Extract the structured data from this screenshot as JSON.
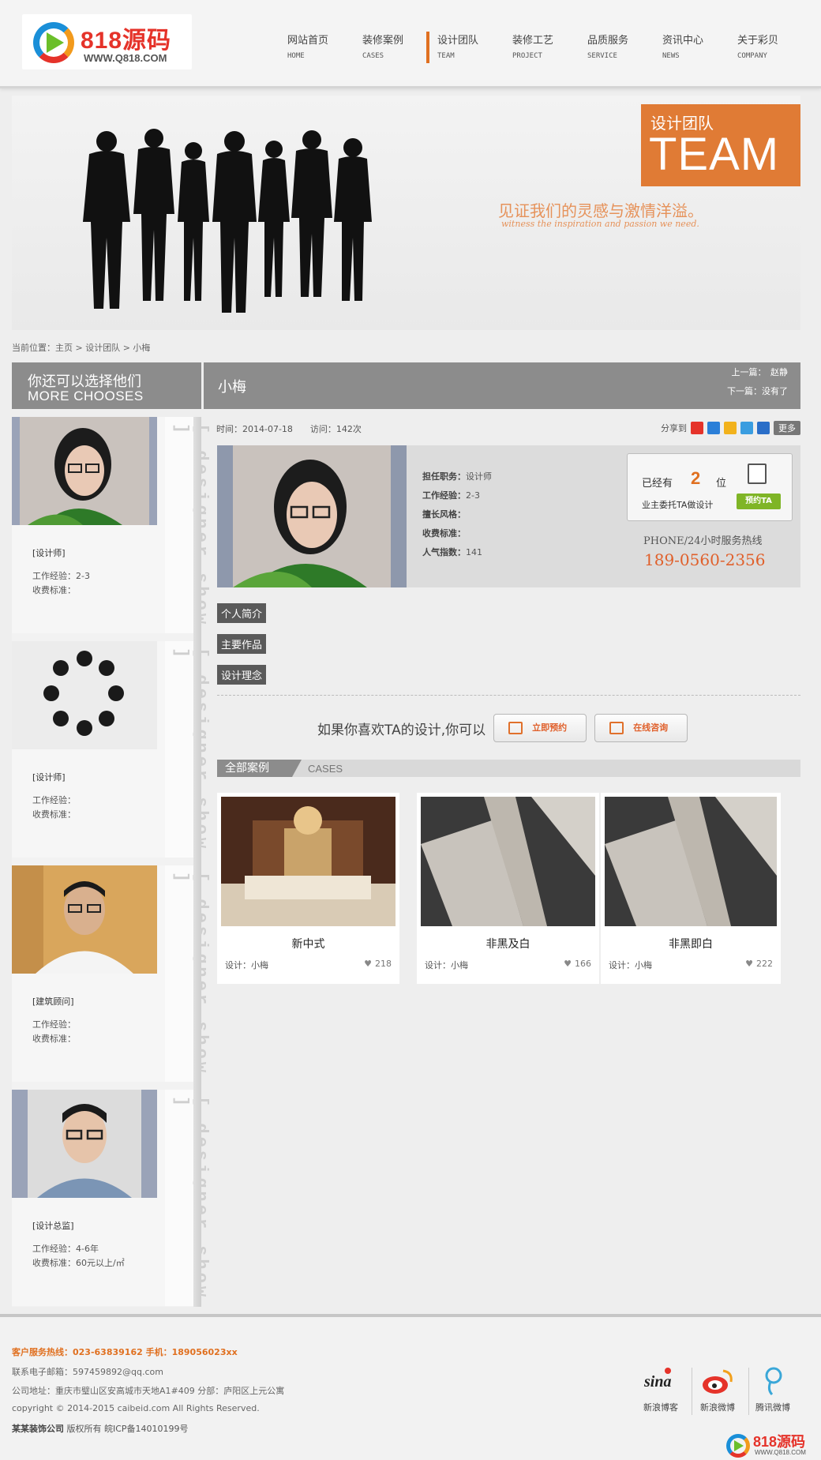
{
  "header": {
    "logo": {
      "main": "818源码",
      "sub": "WWW.Q818.COM"
    },
    "nav": [
      {
        "cn": "网站首页",
        "en": "HOME"
      },
      {
        "cn": "装修案例",
        "en": "CASES"
      },
      {
        "cn": "设计团队",
        "en": "TEAM",
        "active": true
      },
      {
        "cn": "装修工艺",
        "en": "PROJECT"
      },
      {
        "cn": "品质服务",
        "en": "SERVICE"
      },
      {
        "cn": "资讯中心",
        "en": "NEWS"
      },
      {
        "cn": "关于彩贝",
        "en": "COMPANY"
      }
    ]
  },
  "banner": {
    "title_cn": "设计团队",
    "title_en": "TEAM",
    "slogan_cn": "见证我们的灵感与激情洋溢。",
    "slogan_en": "witness the inspiration and passion we need."
  },
  "breadcrumb": "当前位置：主页 > 设计团队 > 小梅",
  "sidebar": {
    "title_cn": "你还可以选择他们",
    "title_en": "MORE CHOOSES",
    "vertical_label": "[ designer show ]",
    "designers": [
      {
        "role": "[设计师]",
        "exp": "工作经验：2-3",
        "fee": "收费标准："
      },
      {
        "role": "[设计师]",
        "exp": "工作经验：",
        "fee": "收费标准："
      },
      {
        "role": "[建筑顾问]",
        "exp": "工作经验：",
        "fee": "收费标准："
      },
      {
        "role": "[设计总监]",
        "exp": "工作经验：4-6年",
        "fee": "收费标准：60元以上/㎡"
      }
    ]
  },
  "main": {
    "name": "小梅",
    "prev": "上一篇：　赵静",
    "next": "下一篇：没有了",
    "meta": "时间：2014-07-18　　访问：142次",
    "share_label": "分享到",
    "share_more": "更多",
    "share_icons": [
      "#e5332a",
      "#2b7fd8",
      "#f2b21c",
      "#3a9de0",
      "#2a6ec8"
    ],
    "profile": {
      "fields": [
        {
          "label": "担任职务：",
          "value": "设计师"
        },
        {
          "label": "工作经验：",
          "value": "2-3"
        },
        {
          "label": "擅长风格：",
          "value": ""
        },
        {
          "label": "收费标准：",
          "value": ""
        },
        {
          "label": "人气指数：",
          "value": "141"
        }
      ],
      "entrust_prefix": "已经有",
      "entrust_count": "2",
      "entrust_unit": "位",
      "entrust_note": "业主委托TA做设计",
      "entrust_button": "预约TA",
      "hotline_label": "PHONE/24小时服务热线",
      "hotline": "189-0560-2356"
    },
    "tabs": [
      "个人简介",
      "主要作品",
      "设计理念"
    ],
    "like_text": "如果你喜欢TA的设计,你可以",
    "like_buttons": [
      "立即预约",
      "在线咨询"
    ],
    "cases_label_cn": "全部案例",
    "cases_label_en": "CASES",
    "cases": [
      {
        "title": "新中式",
        "designer": "设计：小梅",
        "likes": "218"
      },
      {
        "title": "非黑及白",
        "designer": "设计：小梅",
        "likes": "166"
      },
      {
        "title": "非黑即白",
        "designer": "设计：小梅",
        "likes": "222"
      }
    ]
  },
  "footer": {
    "hotline": "客户服务热线：023-63839162 手机：189056023xx",
    "email": "联系电子邮箱：597459892@qq.com",
    "address": "公司地址：重庆市璧山区安高城市天地A1#409 分部：庐阳区上元公寓",
    "copyright": "copyright © 2014-2015 caibeid.com All Rights Reserved.",
    "company": "某某装饰公司",
    "icp": " 版权所有 皖ICP备14010199号",
    "social": [
      "新浪博客",
      "新浪微博",
      "腾讯微博"
    ],
    "bottom_logo_main": "818源码",
    "bottom_logo_sub": "WWW.Q818.COM"
  }
}
